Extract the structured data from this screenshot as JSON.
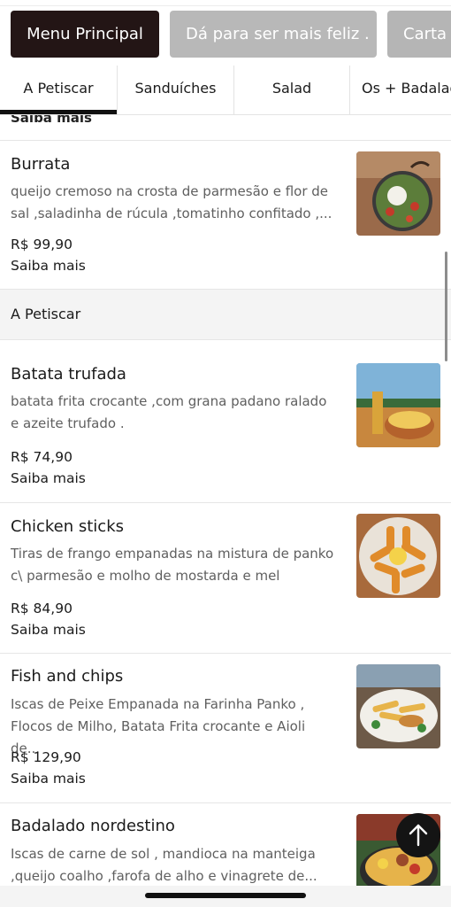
{
  "menus": [
    {
      "label": "Menu Principal",
      "active": true
    },
    {
      "label": "Dá para ser mais feliz .",
      "active": false
    },
    {
      "label": "Carta d",
      "active": false
    }
  ],
  "tabs": [
    "A Petiscar",
    "Sanduíches",
    "Salad",
    "Os + Badalados"
  ],
  "list": {
    "cut_more_label": "Saiba mais",
    "section_title": "A Petiscar",
    "items": [
      {
        "name": "Burrata",
        "desc": "queijo cremoso na crosta de parmesão e flor de sal ,saladinha de rúcula ,tomatinho confitado ,...",
        "price": "R$ 99,90",
        "more": "Saiba mais",
        "image": "burrata-salad-plate"
      },
      {
        "name": "Batata trufada",
        "desc": "batata frita crocante ,com grana padano ralado e azeite trufado .",
        "price": "R$ 74,90",
        "more": "Saiba mais",
        "image": "truffle-fries-bowl"
      },
      {
        "name": "Chicken sticks",
        "desc": "Tiras de frango empanadas na mistura de panko c\\ parmesão e molho de mostarda e mel",
        "price": "R$ 84,90",
        "more": "Saiba mais",
        "image": "chicken-sticks-plate"
      },
      {
        "name": "Fish and chips",
        "desc": "Iscas de Peixe Empanada na Farinha Panko , Flocos de Milho, Batata Frita crocante e Aioli de...",
        "price": "R$ 129,90",
        "more": "Saiba mais",
        "image": "fish-and-chips-plate"
      },
      {
        "name": "Badalado nordestino",
        "desc": "Iscas de carne de sol , mandioca na manteiga ,queijo coalho ,farofa de alho e vinagrete de...",
        "price": "",
        "more": "",
        "image": "badalado-nordestino-plate"
      }
    ]
  },
  "icons": {
    "fab": "arrow-up-icon"
  },
  "colors": {
    "active_menu_bg": "#231515",
    "inactive_menu_bg": "#b8b8b8",
    "section_bg": "#f4f4f4",
    "fab_bg": "#141414"
  }
}
